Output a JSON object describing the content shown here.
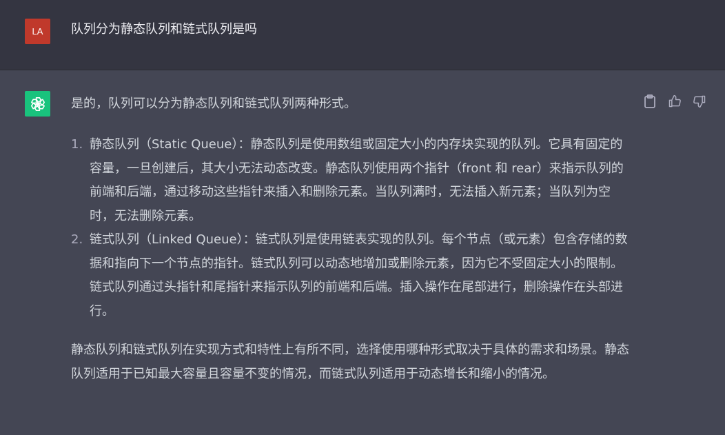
{
  "user": {
    "avatar_text": "LA",
    "message": "队列分为静态队列和链式队列是吗"
  },
  "assistant": {
    "avatar_icon": "openai-logo-icon",
    "intro": "是的，队列可以分为静态队列和链式队列两种形式。",
    "items": [
      {
        "number": "1.",
        "text": "静态队列（Static Queue）：静态队列是使用数组或固定大小的内存块实现的队列。它具有固定的容量，一旦创建后，其大小无法动态改变。静态队列使用两个指针（front 和 rear）来指示队列的前端和后端，通过移动这些指针来插入和删除元素。当队列满时，无法插入新元素；当队列为空时，无法删除元素。"
      },
      {
        "number": "2.",
        "text": "链式队列（Linked Queue）：链式队列是使用链表实现的队列。每个节点（或元素）包含存储的数据和指向下一个节点的指针。链式队列可以动态地增加或删除元素，因为它不受固定大小的限制。链式队列通过头指针和尾指针来指示队列的前端和后端。插入操作在尾部进行，删除操作在头部进行。"
      }
    ],
    "conclusion": "静态队列和链式队列在实现方式和特性上有所不同，选择使用哪种形式取决于具体的需求和场景。静态队列适用于已知最大容量且容量不变的情况，而链式队列适用于动态增长和缩小的情况。"
  },
  "actions": {
    "copy_icon": "clipboard-icon",
    "like_icon": "thumbs-up-icon",
    "dislike_icon": "thumbs-down-icon"
  },
  "colors": {
    "user_bg": "#343541",
    "assistant_bg": "#444654",
    "user_avatar": "#c0392b",
    "assistant_avatar": "#19c37d",
    "text": "#d1d5db"
  }
}
